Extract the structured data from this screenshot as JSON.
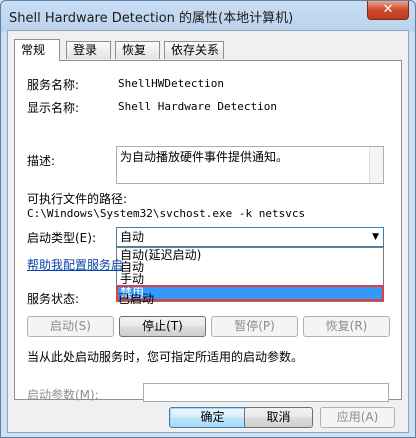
{
  "window": {
    "title": "Shell Hardware Detection 的属性(本地计算机)",
    "close_glyph": "✕"
  },
  "tabs": [
    {
      "label": "常规",
      "active": true
    },
    {
      "label": "登录",
      "active": false
    },
    {
      "label": "恢复",
      "active": false
    },
    {
      "label": "依存关系",
      "active": false
    }
  ],
  "general": {
    "service_name_label": "服务名称:",
    "service_name_value": "ShellHWDetection",
    "display_name_label": "显示名称:",
    "display_name_value": "Shell Hardware Detection",
    "description_label": "描述:",
    "description_value": "为自动播放硬件事件提供通知。",
    "exe_path_label": "可执行文件的路径:",
    "exe_path_value": "C:\\Windows\\System32\\svchost.exe -k netsvcs",
    "startup_type_label": "启动类型(E):",
    "startup_type_value": "自动",
    "startup_options": [
      "自动(延迟启动)",
      "自动",
      "手动",
      "禁用"
    ],
    "startup_selected_index": 3,
    "help_link": "帮助我配置服务启",
    "status_label": "服务状态:",
    "status_value": "已启动",
    "hint_text": "当从此处启动服务时，您可指定所适用的启动参数。",
    "start_params_label": "启动参数(M):",
    "start_params_value": ""
  },
  "control_buttons": {
    "start": "启动(S)",
    "stop": "停止(T)",
    "pause": "暂停(P)",
    "resume": "恢复(R)"
  },
  "dialog_buttons": {
    "ok": "确定",
    "cancel": "取消",
    "apply": "应用(A)"
  }
}
